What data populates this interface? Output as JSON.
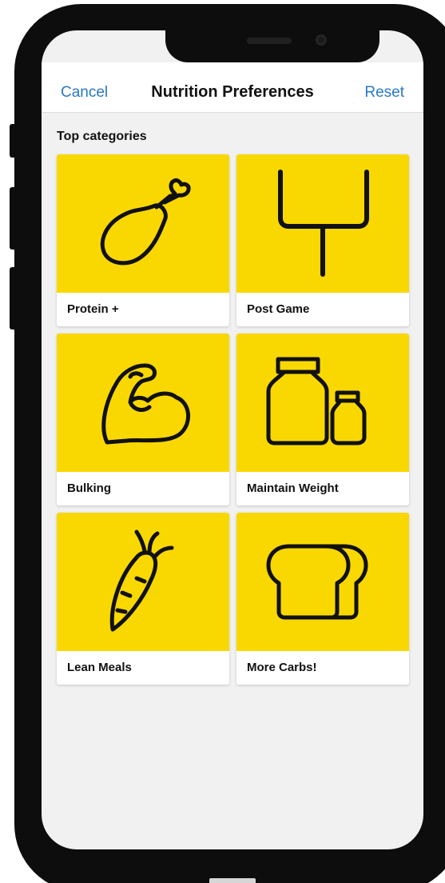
{
  "navbar": {
    "cancel_label": "Cancel",
    "title": "Nutrition Preferences",
    "reset_label": "Reset"
  },
  "section": {
    "title": "Top categories"
  },
  "categories": [
    {
      "label": "Protein +",
      "icon": "chicken-leg-icon"
    },
    {
      "label": "Post Game",
      "icon": "goal-post-icon"
    },
    {
      "label": "Bulking",
      "icon": "flexed-bicep-icon"
    },
    {
      "label": "Maintain Weight",
      "icon": "weights-icon"
    },
    {
      "label": "Lean Meals",
      "icon": "carrot-icon"
    },
    {
      "label": "More Carbs!",
      "icon": "bread-icon"
    }
  ],
  "colors": {
    "card_yellow": "#f9d801",
    "link_blue": "#2a78c6",
    "screen_bg": "#f0f1f0",
    "device": "#0d0d0d"
  }
}
